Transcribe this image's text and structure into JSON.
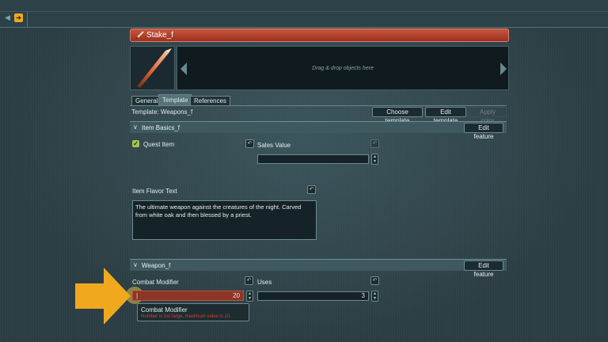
{
  "toolbar": {
    "back_icon": "back-arrow-icon",
    "export_icon": "export-icon"
  },
  "titlebar": {
    "title": "Stake_f",
    "icon": "stake-icon",
    "color": "#b5402b"
  },
  "preview": {
    "drop_text": "Drag & drop objects here"
  },
  "tabs": [
    {
      "label": "General",
      "active": false
    },
    {
      "label": "Template",
      "active": true
    },
    {
      "label": "References",
      "active": false
    }
  ],
  "template": {
    "label": "Template: Weapons_f",
    "choose_label": "Choose template",
    "edit_label": "Edit template",
    "apply_color_label": "Apply color"
  },
  "item_basics": {
    "title": "Item Basics_f",
    "edit_feature_label": "Edit feature",
    "quest_item_label": "Quest Item",
    "quest_item_checked": true,
    "sales_value_label": "Sales Value",
    "sales_value": "",
    "flavor_label": "Item Flavor Text",
    "flavor_text": "The ultimate weapon against the creatures of the night. Carved from white oak and then blessed by a priest."
  },
  "weapon": {
    "title": "Weapon_f",
    "edit_feature_label": "Edit feature",
    "combat_modifier_label": "Combat Modifier",
    "combat_modifier_value": "20",
    "uses_label": "Uses",
    "uses_value": "3",
    "tooltip_title": "Combat Modifier",
    "tooltip_message": "Number is too large, maximum value is 10."
  },
  "colors": {
    "accent": "#f0a81e",
    "error": "#e23b2f",
    "title_red": "#b5402b"
  }
}
